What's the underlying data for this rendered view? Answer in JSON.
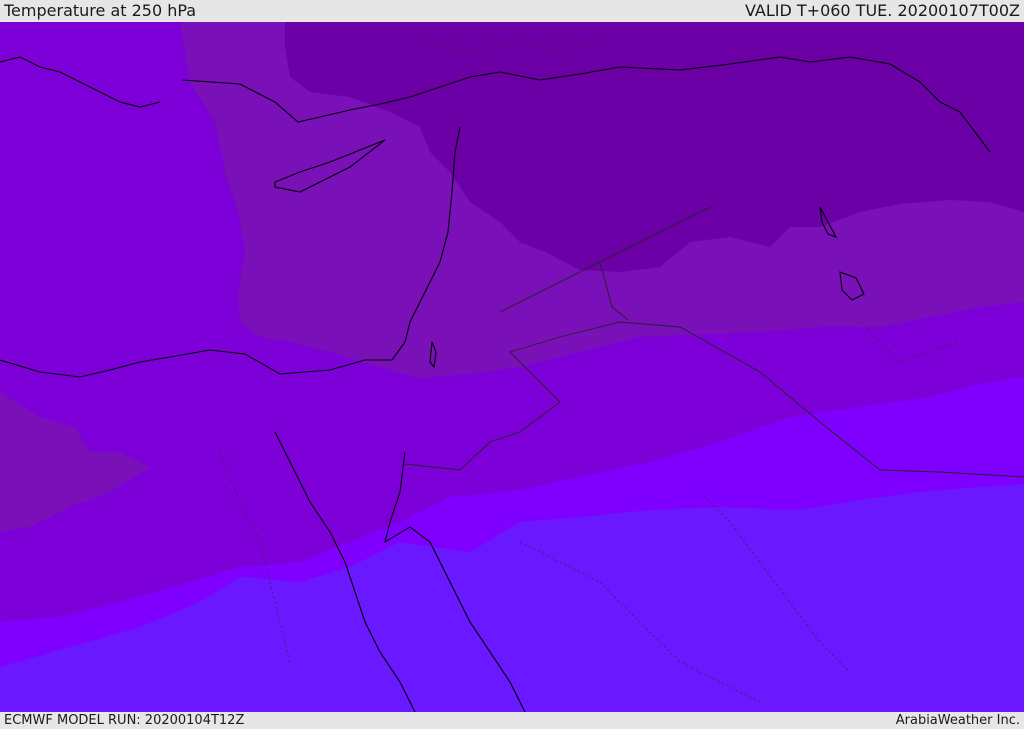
{
  "header": {
    "title": "Temperature at 250 hPa",
    "valid": "VALID T+060 TUE. 20200107T00Z"
  },
  "footer": {
    "model_run": "ECMWF MODEL RUN: 20200104T12Z",
    "credit": "ArabiaWeather Inc."
  },
  "colors": {
    "coldest_band": "#6a00a6",
    "cold_band": "#7a10b8",
    "mid_band": "#7d00d8",
    "warmer_band": "#8000ff",
    "warmest_band": "#6a18ff",
    "coastline": "#000000",
    "border": "#222222"
  }
}
